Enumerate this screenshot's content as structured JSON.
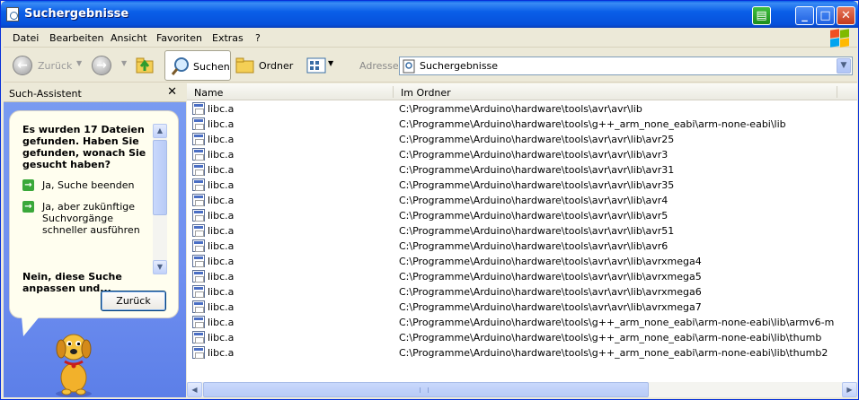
{
  "window": {
    "title": "Suchergebnisse",
    "title_icon": "search-document-icon",
    "buttons": [
      "minimize",
      "maximize",
      "close"
    ]
  },
  "menu": [
    "Datei",
    "Bearbeiten",
    "Ansicht",
    "Favoriten",
    "Extras",
    "?"
  ],
  "toolbar": {
    "back_label": "Zurück",
    "search_label": "Suchen",
    "folders_label": "Ordner",
    "address_label": "Adresse",
    "address_value": "Suchergebnisse"
  },
  "assistant": {
    "title": "Such-Assistent",
    "heading": "Es wurden 17 Dateien gefunden. Haben Sie gefunden, wonach Sie gesucht haben?",
    "options": [
      "Ja, Suche beenden",
      "Ja, aber zukünftige Suchvorgänge schneller ausführen"
    ],
    "bold_option": "Nein, diese Suche anpassen und...",
    "back_button": "Zurück"
  },
  "results": {
    "columns": [
      "Name",
      "Im Ordner"
    ],
    "rows": [
      {
        "name": "libc.a",
        "folder": "C:\\Programme\\Arduino\\hardware\\tools\\avr\\avr\\lib"
      },
      {
        "name": "libc.a",
        "folder": "C:\\Programme\\Arduino\\hardware\\tools\\g++_arm_none_eabi\\arm-none-eabi\\lib"
      },
      {
        "name": "libc.a",
        "folder": "C:\\Programme\\Arduino\\hardware\\tools\\avr\\avr\\lib\\avr25"
      },
      {
        "name": "libc.a",
        "folder": "C:\\Programme\\Arduino\\hardware\\tools\\avr\\avr\\lib\\avr3"
      },
      {
        "name": "libc.a",
        "folder": "C:\\Programme\\Arduino\\hardware\\tools\\avr\\avr\\lib\\avr31"
      },
      {
        "name": "libc.a",
        "folder": "C:\\Programme\\Arduino\\hardware\\tools\\avr\\avr\\lib\\avr35"
      },
      {
        "name": "libc.a",
        "folder": "C:\\Programme\\Arduino\\hardware\\tools\\avr\\avr\\lib\\avr4"
      },
      {
        "name": "libc.a",
        "folder": "C:\\Programme\\Arduino\\hardware\\tools\\avr\\avr\\lib\\avr5"
      },
      {
        "name": "libc.a",
        "folder": "C:\\Programme\\Arduino\\hardware\\tools\\avr\\avr\\lib\\avr51"
      },
      {
        "name": "libc.a",
        "folder": "C:\\Programme\\Arduino\\hardware\\tools\\avr\\avr\\lib\\avr6"
      },
      {
        "name": "libc.a",
        "folder": "C:\\Programme\\Arduino\\hardware\\tools\\avr\\avr\\lib\\avrxmega4"
      },
      {
        "name": "libc.a",
        "folder": "C:\\Programme\\Arduino\\hardware\\tools\\avr\\avr\\lib\\avrxmega5"
      },
      {
        "name": "libc.a",
        "folder": "C:\\Programme\\Arduino\\hardware\\tools\\avr\\avr\\lib\\avrxmega6"
      },
      {
        "name": "libc.a",
        "folder": "C:\\Programme\\Arduino\\hardware\\tools\\avr\\avr\\lib\\avrxmega7"
      },
      {
        "name": "libc.a",
        "folder": "C:\\Programme\\Arduino\\hardware\\tools\\g++_arm_none_eabi\\arm-none-eabi\\lib\\armv6-m"
      },
      {
        "name": "libc.a",
        "folder": "C:\\Programme\\Arduino\\hardware\\tools\\g++_arm_none_eabi\\arm-none-eabi\\lib\\thumb"
      },
      {
        "name": "libc.a",
        "folder": "C:\\Programme\\Arduino\\hardware\\tools\\g++_arm_none_eabi\\arm-none-eabi\\lib\\thumb2"
      }
    ]
  },
  "colors": {
    "titlebar": "#0a5fe8",
    "assistant_bg": "#7a9cf1",
    "balloon_bg": "#fffeef"
  }
}
